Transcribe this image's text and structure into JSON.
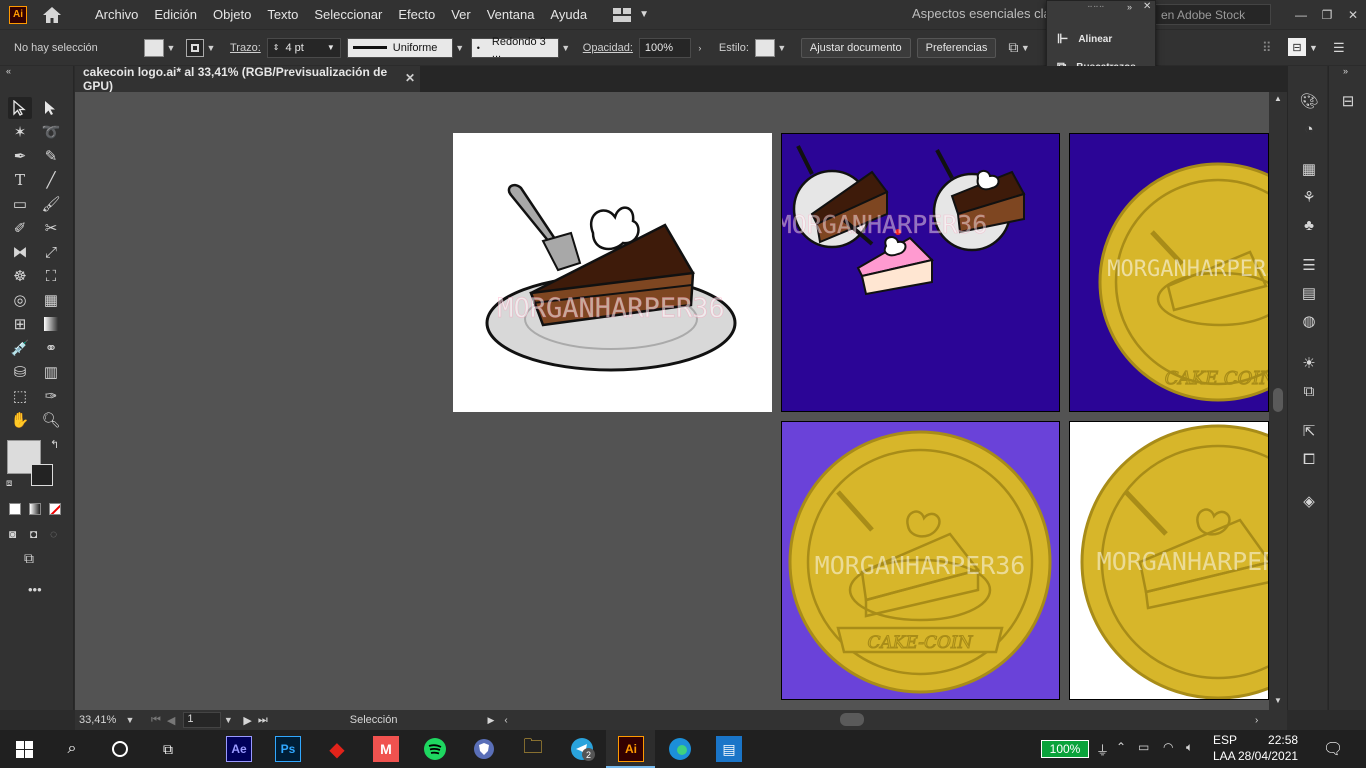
{
  "menu": {
    "items": [
      "Archivo",
      "Edición",
      "Objeto",
      "Texto",
      "Seleccionar",
      "Efecto",
      "Ver",
      "Ventana",
      "Ayuda"
    ],
    "workspace": "Aspectos esenciales clásic",
    "stock_search_placeholder": "en Adobe Stock"
  },
  "control_bar": {
    "selection": "No hay selección",
    "stroke_label": "Trazo:",
    "stroke_weight": "4 pt",
    "profile": "Uniforme",
    "brush": "Redondo 3 ...",
    "opacity_label": "Opacidad:",
    "opacity_value": "100%",
    "style_label": "Estilo:",
    "adjust_doc": "Ajustar documento",
    "preferences": "Preferencias"
  },
  "flyout": {
    "items": [
      "Alinear",
      "Buscatrazos"
    ]
  },
  "document": {
    "tab_title": "cakecoin logo.ai* al 33,41% (RGB/Previsualización de GPU)"
  },
  "artwork": {
    "watermark": "MORGANHARPER36",
    "coin_banner": "CAKE-COIN",
    "coin_banner_alt": "CAKE COIN",
    "colors": {
      "dark_blue": "#2b0596",
      "purple": "#6a42d9",
      "gold": "#d7b62a",
      "gold_line": "#a88c18",
      "choc_dark": "#3e1b0a",
      "choc_mid": "#7e4621",
      "plate": "#d8d8d8"
    }
  },
  "status": {
    "zoom": "33,41%",
    "artboard": "1",
    "tool": "Selección"
  },
  "taskbar": {
    "battery": "100%",
    "lang1": "ESP",
    "lang2": "LAA",
    "time": "22:58",
    "date": "28/04/2021",
    "badge": "2"
  }
}
